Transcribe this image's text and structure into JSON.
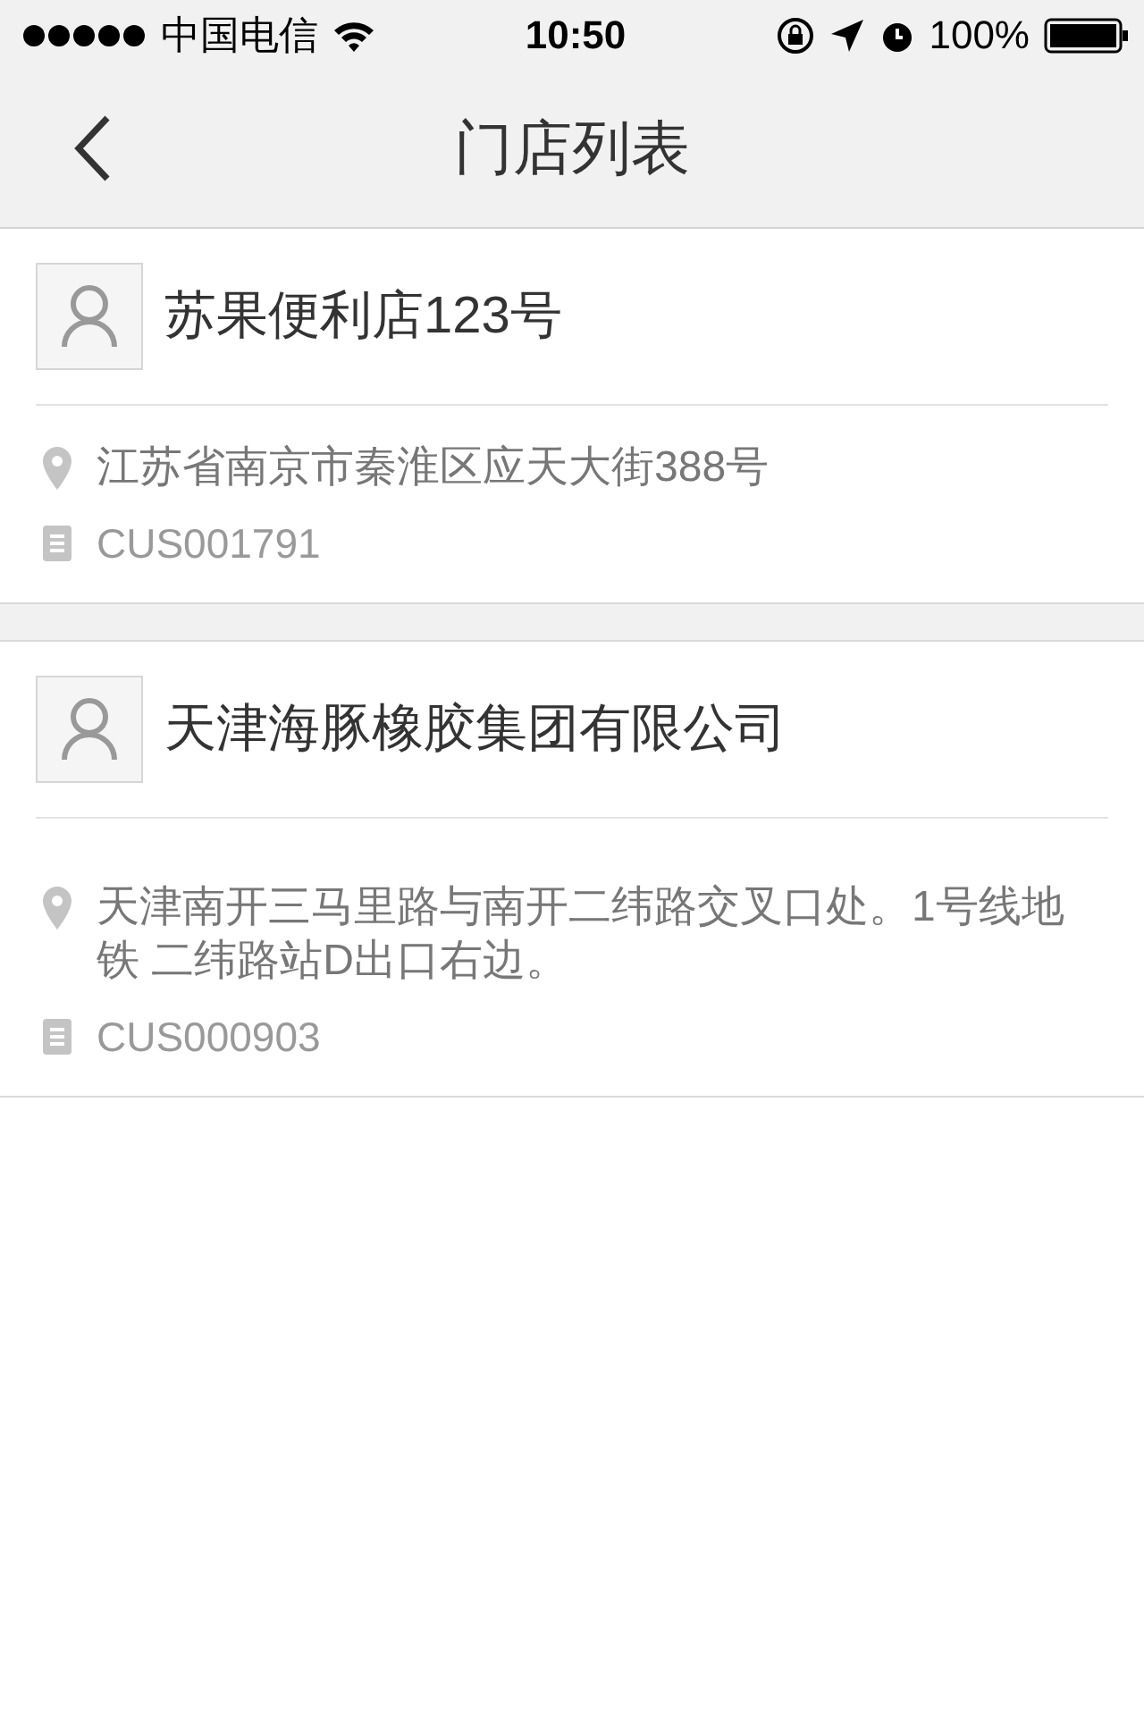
{
  "status_bar": {
    "carrier": "中国电信",
    "time": "10:50",
    "battery": "100%"
  },
  "nav": {
    "title": "门店列表"
  },
  "stores": [
    {
      "name": "苏果便利店123号",
      "address": "江苏省南京市秦淮区应天大街388号",
      "code": "CUS001791"
    },
    {
      "name": "天津海豚橡胶集团有限公司",
      "address": "天津南开三马里路与南开二纬路交叉口处。1号线地铁 二纬路站D出口右边。",
      "code": "CUS000903"
    }
  ]
}
